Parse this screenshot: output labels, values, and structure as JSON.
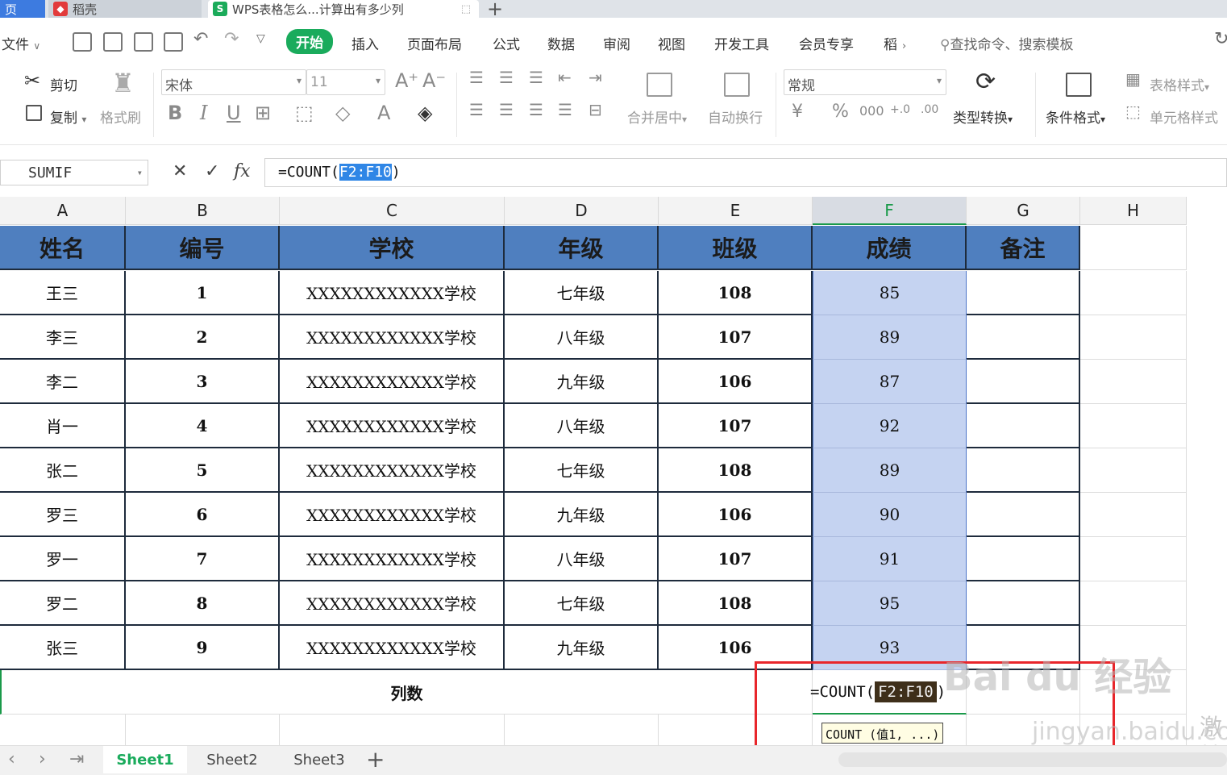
{
  "tabs": {
    "home": "页",
    "daoke": "稻壳",
    "active": "WPS表格怎么...计算出有多少列"
  },
  "menu": {
    "file": "文件",
    "items": [
      "开始",
      "插入",
      "页面布局",
      "公式",
      "数据",
      "审阅",
      "视图",
      "开发工具",
      "会员专享",
      "稻"
    ],
    "search": "查找命令、搜索模板"
  },
  "ribbon": {
    "cut": "剪切",
    "copy": "复制",
    "format_painter": "格式刷",
    "font_name": "宋体",
    "font_size": "11",
    "merge_center": "合并居中",
    "wrap": "自动换行",
    "number_format": "常规",
    "type_convert": "类型转换",
    "conditional": "条件格式",
    "table_style": "表格样式",
    "cell_style": "单元格样式"
  },
  "formula_bar": {
    "name_box": "SUMIF",
    "formula_prefix": "=COUNT(",
    "formula_ref": "F2:F10",
    "formula_suffix": ")"
  },
  "columns": [
    "A",
    "B",
    "C",
    "D",
    "E",
    "F",
    "G",
    "H"
  ],
  "table": {
    "headers": [
      "姓名",
      "编号",
      "学校",
      "年级",
      "班级",
      "成绩",
      "备注"
    ],
    "rows": [
      [
        "王三",
        "1",
        "XXXXXXXXXXXX学校",
        "七年级",
        "108",
        "85"
      ],
      [
        "李三",
        "2",
        "XXXXXXXXXXXX学校",
        "八年级",
        "107",
        "89"
      ],
      [
        "李二",
        "3",
        "XXXXXXXXXXXX学校",
        "九年级",
        "106",
        "87"
      ],
      [
        "肖一",
        "4",
        "XXXXXXXXXXXX学校",
        "八年级",
        "107",
        "92"
      ],
      [
        "张二",
        "5",
        "XXXXXXXXXXXX学校",
        "七年级",
        "108",
        "89"
      ],
      [
        "罗三",
        "6",
        "XXXXXXXXXXXX学校",
        "九年级",
        "106",
        "90"
      ],
      [
        "罗一",
        "7",
        "XXXXXXXXXXXX学校",
        "八年级",
        "107",
        "91"
      ],
      [
        "罗二",
        "8",
        "XXXXXXXXXXXX学校",
        "七年级",
        "108",
        "95"
      ],
      [
        "张三",
        "9",
        "XXXXXXXXXXXX学校",
        "九年级",
        "106",
        "93"
      ]
    ],
    "summary_label": "列数",
    "cell_formula_prefix": "=COUNT(",
    "cell_formula_ref": "F2:F10",
    "cell_formula_suffix": ")",
    "tooltip": "COUNT (值1, ...)"
  },
  "watermark": {
    "brand": "Bai du 经验",
    "url": "jingyan.baidu.com",
    "edge": "激 转"
  },
  "sheets": [
    "Sheet1",
    "Sheet2",
    "Sheet3"
  ],
  "colors": {
    "accent_green": "#1aab5c",
    "header_blue": "#4f7fbf",
    "selection": "#c5d3f1",
    "highlight_box": "#e8262b"
  }
}
